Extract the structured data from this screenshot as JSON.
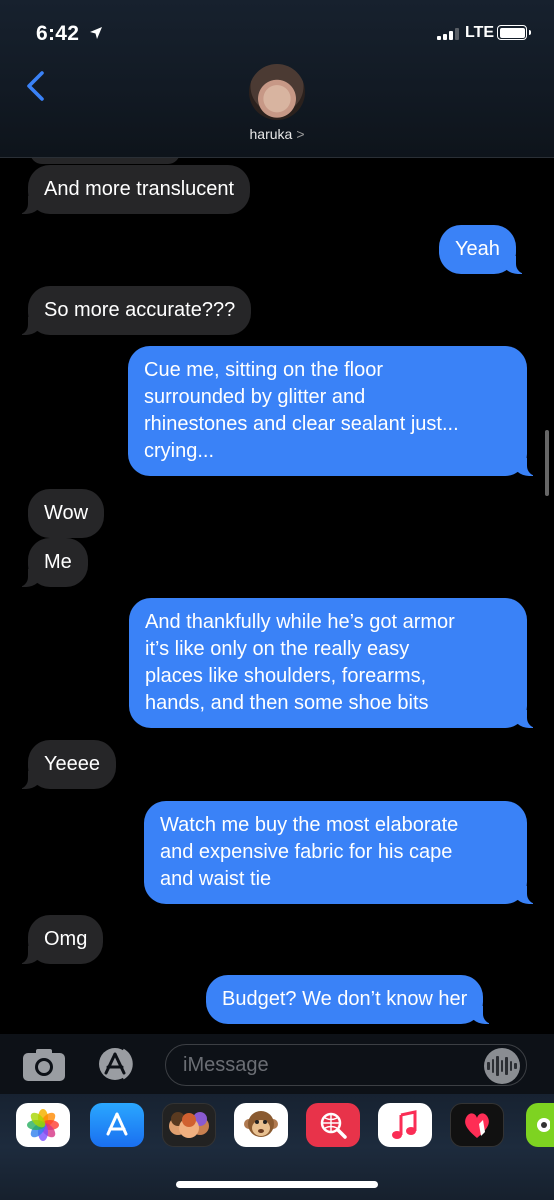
{
  "status_bar": {
    "time": "6:42",
    "network": "LTE"
  },
  "contact": {
    "name": "haruka",
    "chevron": ">"
  },
  "messages": [
    {
      "dir": "in",
      "text": "And more translucent"
    },
    {
      "dir": "out",
      "text": "Yeah"
    },
    {
      "dir": "in",
      "text": "So more accurate???"
    },
    {
      "dir": "out",
      "text": "Cue me, sitting on the floor\nsurrounded by glitter and\nrhinestones and clear sealant just...\ncrying..."
    },
    {
      "dir": "in",
      "text": "Wow"
    },
    {
      "dir": "in",
      "text": "Me"
    },
    {
      "dir": "out",
      "text": "And thankfully while he’s got armor\nit’s like only on the really easy\nplaces like shoulders, forearms,\nhands, and then some shoe bits"
    },
    {
      "dir": "in",
      "text": "Yeeee"
    },
    {
      "dir": "out",
      "text": "Watch me buy the most elaborate\nand expensive fabric for his cape\nand waist tie"
    },
    {
      "dir": "in",
      "text": "Omg"
    },
    {
      "dir": "out",
      "text": "Budget? We don’t know her"
    }
  ],
  "input": {
    "placeholder": "iMessage"
  },
  "icons": {
    "location": "location-arrow-icon",
    "back": "chevron-left-icon",
    "camera": "camera-icon",
    "app_store": "app-store-icon",
    "audio": "audio-waveform-icon",
    "apps": [
      "photos-app-icon",
      "app-store-app-icon",
      "memoji-app-icon",
      "animoji-app-icon",
      "web-search-app-icon",
      "music-app-icon",
      "digital-touch-app-icon",
      "partial-app-icon"
    ]
  },
  "colors": {
    "outgoing": "#3a82f7",
    "incoming": "#262628",
    "accent": "#3a82f7"
  }
}
